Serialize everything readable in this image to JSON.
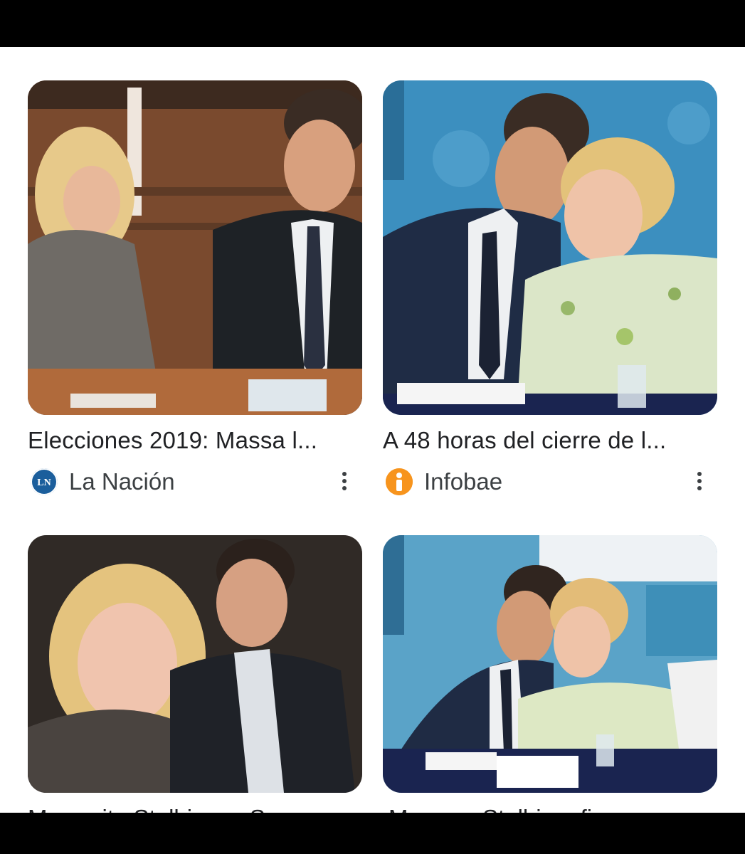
{
  "results": [
    {
      "title": "Elecciones 2019: Massa l...",
      "source": "La Nación",
      "source_icon": "la-nacion-logo",
      "logo_text": "LN",
      "logo_color": "#1b5e9c"
    },
    {
      "title": "A 48 horas del cierre de l...",
      "source": "Infobae",
      "source_icon": "infobae-logo",
      "logo_color": "#f7941d"
    },
    {
      "title": "Margarita Stolbizer y Ser...",
      "source": "",
      "source_icon": ""
    },
    {
      "title": "Massa y Stolbizer firman...",
      "source": "",
      "source_icon": ""
    }
  ]
}
